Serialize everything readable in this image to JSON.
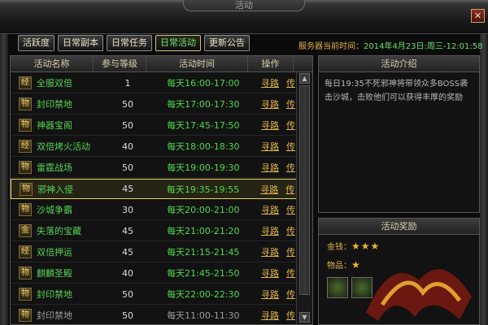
{
  "window": {
    "title": "活动"
  },
  "tabs": [
    {
      "label": "活跃度"
    },
    {
      "label": "日常副本"
    },
    {
      "label": "日常任务"
    },
    {
      "label": "日常活动"
    },
    {
      "label": "更新公告"
    }
  ],
  "server_time": {
    "label": "服务器当前时间：",
    "value": "2014年4月23日:周三-12:01:58"
  },
  "table": {
    "headers": [
      "活动名称",
      "参与等级",
      "活动时间",
      "操作"
    ],
    "rows": [
      {
        "icon": "经",
        "name": "全服双倍",
        "level": "1",
        "time": "每天16:00-17:00",
        "op1": "寻路",
        "op2": "传"
      },
      {
        "icon": "物",
        "name": "封印禁地",
        "level": "50",
        "time": "每天17:00-17:30",
        "op1": "寻路",
        "op2": "传"
      },
      {
        "icon": "物",
        "name": "神器宝阁",
        "level": "50",
        "time": "每天17:45-17:50",
        "op1": "寻路",
        "op2": "传"
      },
      {
        "icon": "经",
        "name": "双倍烤火活动",
        "level": "40",
        "time": "每天18:00-18:30",
        "op1": "寻路",
        "op2": "传"
      },
      {
        "icon": "物",
        "name": "雷霆战场",
        "level": "50",
        "time": "每天19:00-19:30",
        "op1": "寻路",
        "op2": "传"
      },
      {
        "icon": "物",
        "name": "邪神入侵",
        "level": "45",
        "time": "每天19:35-19:55",
        "op1": "寻路",
        "op2": "传"
      },
      {
        "icon": "物",
        "name": "沙城争霸",
        "level": "30",
        "time": "每天20:00-21:00",
        "op1": "寻路",
        "op2": "传"
      },
      {
        "icon": "金",
        "name": "失落的宝藏",
        "level": "45",
        "time": "每天21:00-21:20",
        "op1": "寻路",
        "op2": "传"
      },
      {
        "icon": "经",
        "name": "双倍押运",
        "level": "45",
        "time": "每天21:15-21:45",
        "op1": "寻路",
        "op2": "传"
      },
      {
        "icon": "物",
        "name": "麒麟圣殿",
        "level": "40",
        "time": "每天21:45-21:50",
        "op1": "寻路",
        "op2": "传"
      },
      {
        "icon": "物",
        "name": "封印禁地",
        "level": "50",
        "time": "每天22:00-22:30",
        "op1": "寻路",
        "op2": "传"
      },
      {
        "icon": "物",
        "name": "封印禁地",
        "level": "50",
        "time": "每天11:00-11:30",
        "op1": "寻路",
        "op2": "传"
      }
    ]
  },
  "intro": {
    "title": "活动介绍",
    "text": "每日19:35不死邪神将带领众多BOSS袭击沙城，击败他们可以获得丰厚的奖励"
  },
  "reward": {
    "title": "活动奖励",
    "gold_label": "金钱：",
    "gold_stars": "★★★",
    "item_label": "物品：",
    "item_stars": "★"
  },
  "colors": {
    "accent_green": "#4fd94f",
    "gold": "#e0b34a",
    "selected_border": "#e1d06a"
  }
}
